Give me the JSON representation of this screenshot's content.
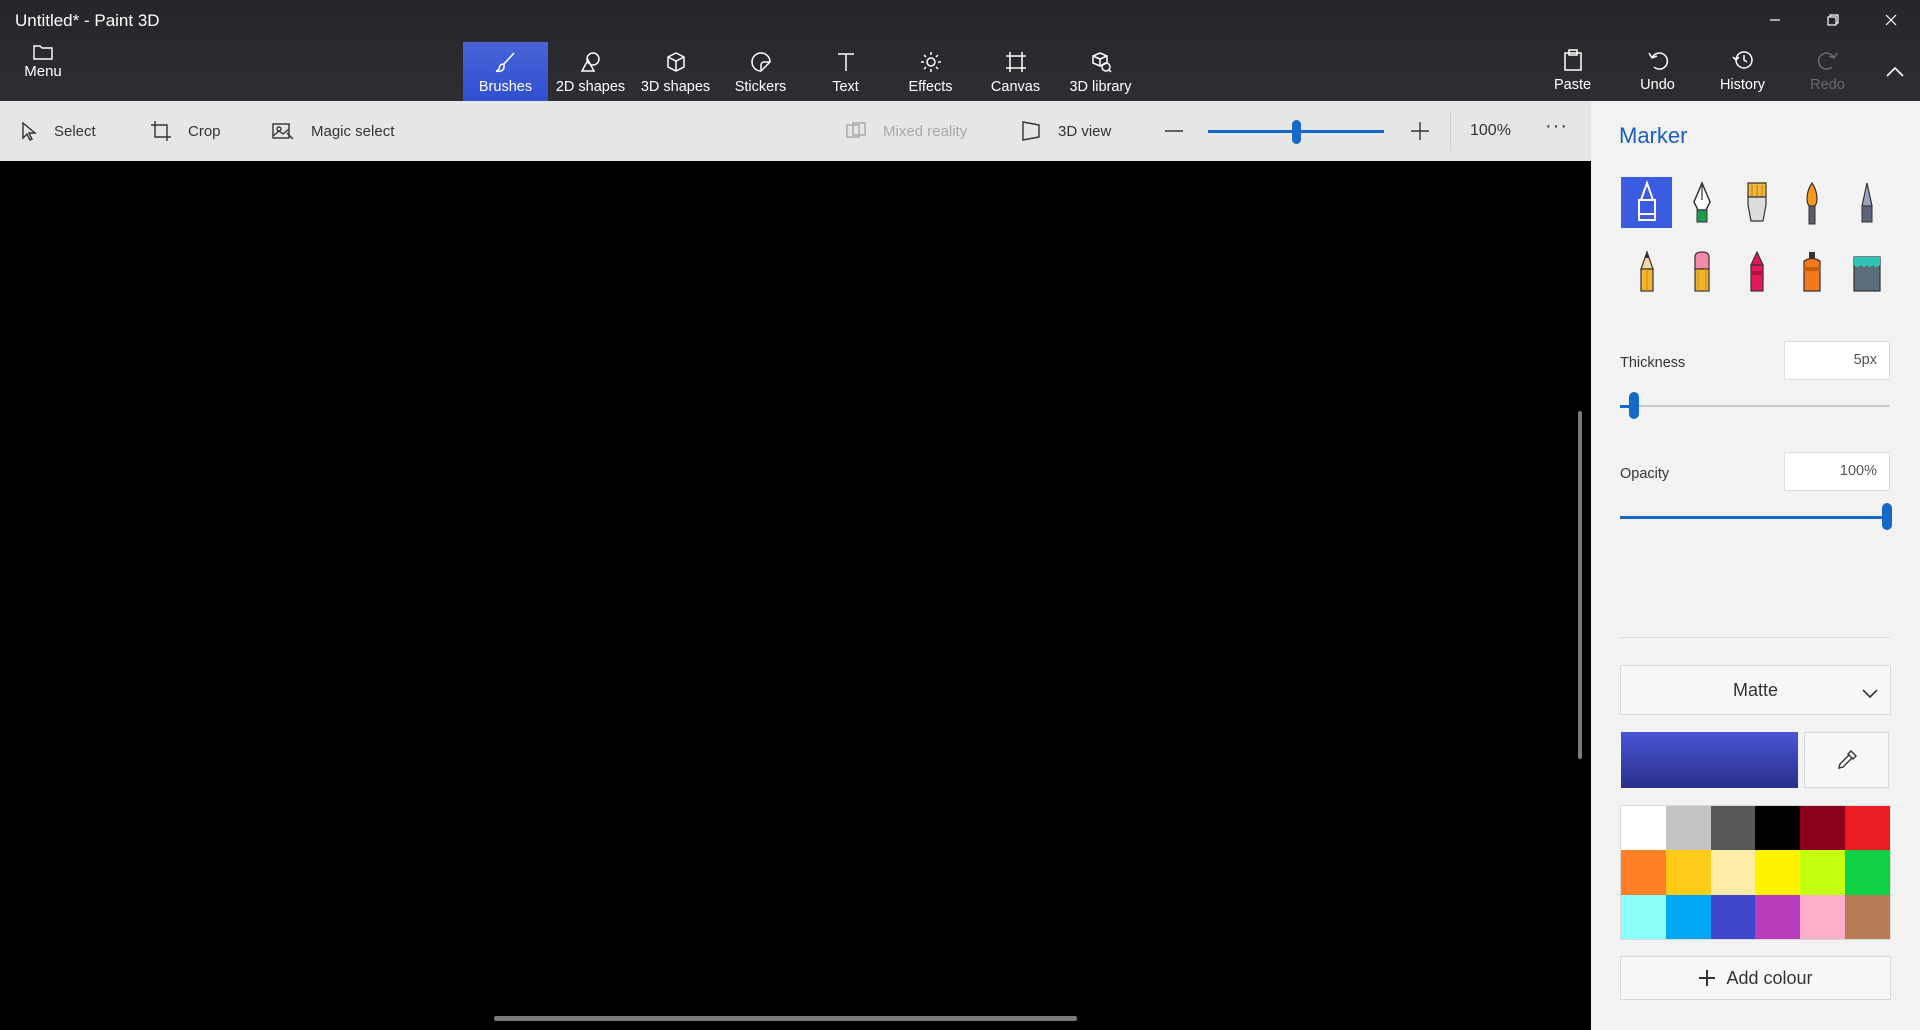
{
  "window": {
    "title": "Untitled* - Paint 3D",
    "controls": [
      "minimize-icon",
      "restore-icon",
      "close-icon"
    ]
  },
  "menu": {
    "label": "Menu",
    "icon": "folder-icon"
  },
  "tools": [
    {
      "label": "Brushes",
      "icon": "brush-icon",
      "active": true
    },
    {
      "label": "2D shapes",
      "icon": "2d-shapes-icon"
    },
    {
      "label": "3D shapes",
      "icon": "cube-icon"
    },
    {
      "label": "Stickers",
      "icon": "sticker-icon"
    },
    {
      "label": "Text",
      "icon": "text-icon"
    },
    {
      "label": "Effects",
      "icon": "sun-icon"
    },
    {
      "label": "Canvas",
      "icon": "canvas-icon"
    },
    {
      "label": "3D library",
      "icon": "3d-library-icon"
    }
  ],
  "right_tools": [
    {
      "label": "Paste",
      "icon": "paste-icon"
    },
    {
      "label": "Undo",
      "icon": "undo-icon"
    },
    {
      "label": "History",
      "icon": "history-icon"
    },
    {
      "label": "Redo",
      "icon": "redo-icon",
      "disabled": true
    }
  ],
  "toolbar2": {
    "select": "Select",
    "crop": "Crop",
    "magic_select": "Magic select",
    "mixed_reality": "Mixed reality",
    "view_3d": "3D view",
    "zoom_percent": "100%",
    "zoom_level": 0.5,
    "more": "···"
  },
  "panel": {
    "title": "Marker",
    "brushes": [
      {
        "name": "marker",
        "active": true
      },
      {
        "name": "calligraphy-pen"
      },
      {
        "name": "oil-brush"
      },
      {
        "name": "watercolour"
      },
      {
        "name": "pixel-pen"
      },
      {
        "name": "pencil"
      },
      {
        "name": "eraser"
      },
      {
        "name": "crayon"
      },
      {
        "name": "spray-can"
      },
      {
        "name": "fill-bucket"
      }
    ],
    "thickness": {
      "label": "Thickness",
      "value": "5px",
      "level": 0.05
    },
    "opacity": {
      "label": "Opacity",
      "value": "100%",
      "level": 1.0
    },
    "finish": "Matte",
    "current_colour": "#3a44c4",
    "palette": [
      "#ffffff",
      "#c3c3c3",
      "#585858",
      "#000000",
      "#88001b",
      "#ec1c24",
      "#ff7f27",
      "#ffca18",
      "#fdeca6",
      "#fff200",
      "#c4ff0e",
      "#0ed145",
      "#8cfffb",
      "#00a8f3",
      "#3f48cc",
      "#b83dba",
      "#ffaec8",
      "#b97a56"
    ],
    "add_colour": "Add colour"
  }
}
